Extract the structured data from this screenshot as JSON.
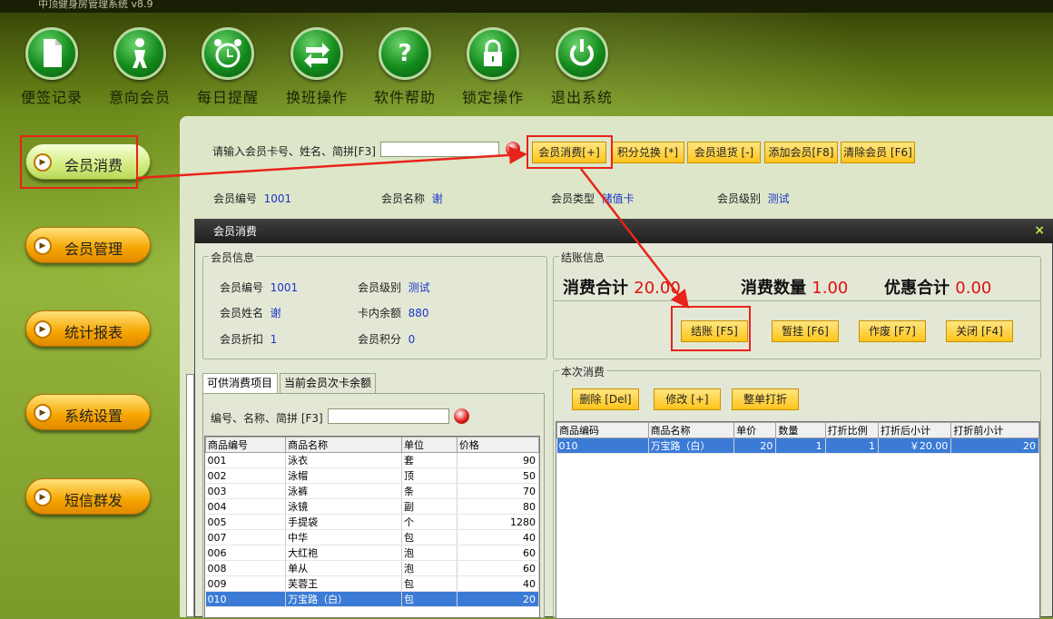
{
  "app": {
    "title": "中顶健身房管理系统 v8.9"
  },
  "toolbar": [
    {
      "label": "便签记录",
      "icon": "note-icon"
    },
    {
      "label": "意向会员",
      "icon": "person-icon"
    },
    {
      "label": "每日提醒",
      "icon": "alarm-clock-icon"
    },
    {
      "label": "换班操作",
      "icon": "swap-arrows-icon"
    },
    {
      "label": "软件帮助",
      "icon": "help-icon"
    },
    {
      "label": "锁定操作",
      "icon": "lock-icon"
    },
    {
      "label": "退出系统",
      "icon": "power-icon"
    }
  ],
  "sidebar": [
    "会员消费",
    "会员管理",
    "统计报表",
    "系统设置",
    "短信群发"
  ],
  "search": {
    "label": "请输入会员卡号、姓名、简拼[F3]",
    "value": ""
  },
  "actions": [
    "会员消费[+]",
    "积分兑换 [*]",
    "会员退货 [-]",
    "添加会员[F8]",
    "清除会员 [F6]"
  ],
  "member_summary": {
    "id_label": "会员编号",
    "id": "1001",
    "name_label": "会员名称",
    "name": "谢",
    "type_label": "会员类型",
    "type": "储值卡",
    "level_label": "会员级别",
    "level": "测试"
  },
  "dialog": {
    "title": "会员消费",
    "close": "×",
    "info_group": "会员信息",
    "info": {
      "id_label": "会员编号",
      "id": "1001",
      "level_label": "会员级别",
      "level": "测试",
      "name_label": "会员姓名",
      "name": "谢",
      "balance_label": "卡内余额",
      "balance": "880",
      "discount_label": "会员折扣",
      "discount": "1",
      "points_label": "会员积分",
      "points": "0"
    },
    "checkout_group": "结账信息",
    "totals": {
      "total_label": "消费合计",
      "total": "20.00",
      "qty_label": "消费数量",
      "qty": "1.00",
      "discount_label": "优惠合计",
      "discount": "0.00"
    },
    "buttons": {
      "checkout": "结账 [F5]",
      "hold": "暂挂 [F6]",
      "void": "作废 [F7]",
      "close": "关闭 [F4]"
    },
    "tabs": [
      "可供消费项目",
      "当前会员次卡余额"
    ],
    "product_search": {
      "label": "编号、名称、简拼 [F3]",
      "value": ""
    },
    "products": {
      "headers": [
        "商品编号",
        "商品名称",
        "单位",
        "价格"
      ],
      "rows": [
        [
          "001",
          "泳衣",
          "套",
          "90"
        ],
        [
          "002",
          "泳帽",
          "顶",
          "50"
        ],
        [
          "003",
          "泳裤",
          "条",
          "70"
        ],
        [
          "004",
          "泳镜",
          "副",
          "80"
        ],
        [
          "005",
          "手提袋",
          "个",
          "1280"
        ],
        [
          "007",
          "中华",
          "包",
          "40"
        ],
        [
          "006",
          "大红袍",
          "泡",
          "60"
        ],
        [
          "008",
          "单从",
          "泡",
          "60"
        ],
        [
          "009",
          "芙蓉王",
          "包",
          "40"
        ],
        [
          "010",
          "万宝路（白）",
          "包",
          "20"
        ]
      ],
      "selected": 9
    },
    "current_group": "本次消费",
    "current_buttons": {
      "delete": "删除 [Del]",
      "edit": "修改 [+]",
      "discount": "整单打折"
    },
    "current": {
      "headers": [
        "商品编码",
        "商品名称",
        "单价",
        "数量",
        "打折比例",
        "打折后小计",
        "打折前小计"
      ],
      "rows": [
        [
          "010",
          "万宝路（白）",
          "20",
          "1",
          "1",
          "￥20.00",
          "20"
        ]
      ]
    }
  },
  "colors": {
    "accent": "#ffc41c",
    "highlight": "#e8231a",
    "selection": "#3b7bd6"
  }
}
